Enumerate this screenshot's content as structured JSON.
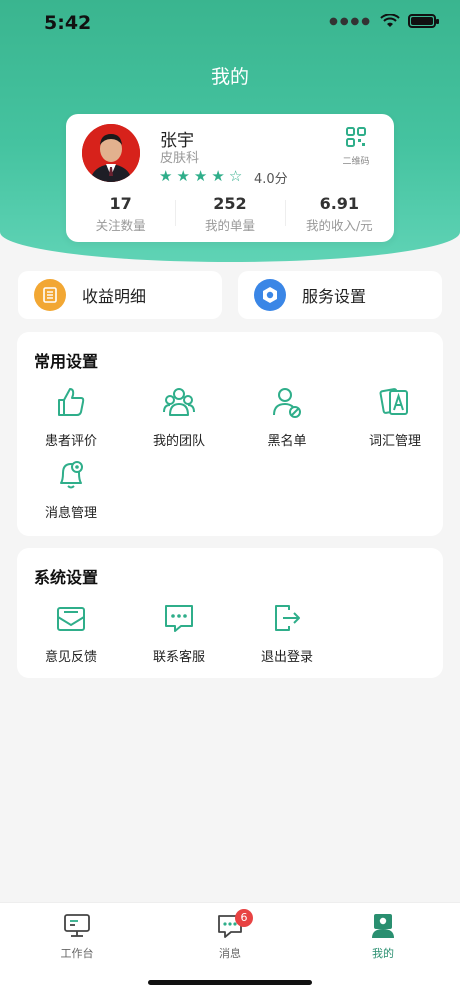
{
  "status_bar": {
    "time": "5:42"
  },
  "header": {
    "title": "我的"
  },
  "profile": {
    "name": "张宇",
    "department": "皮肤科",
    "rating_stars": 4,
    "rating_max": 5,
    "score": "4.0分",
    "qr_label": "二维码",
    "stats": [
      {
        "value": "17",
        "label": "关注数量"
      },
      {
        "value": "252",
        "label": "我的单量"
      },
      {
        "value": "6.91",
        "label": "我的收入/元"
      }
    ]
  },
  "quick_cards": [
    {
      "label": "收益明细",
      "icon": "ledger-icon",
      "color": "#f2a733"
    },
    {
      "label": "服务设置",
      "icon": "service-settings-icon",
      "color": "#3a86e6"
    }
  ],
  "common_settings": {
    "title": "常用设置",
    "items": [
      {
        "label": "患者评价",
        "icon": "thumbs-up-icon"
      },
      {
        "label": "我的团队",
        "icon": "team-icon"
      },
      {
        "label": "黑名单",
        "icon": "blacklist-icon"
      },
      {
        "label": "词汇管理",
        "icon": "vocabulary-icon"
      },
      {
        "label": "消息管理",
        "icon": "message-bell-icon"
      }
    ]
  },
  "system_settings": {
    "title": "系统设置",
    "items": [
      {
        "label": "意见反馈",
        "icon": "feedback-mail-icon"
      },
      {
        "label": "联系客服",
        "icon": "customer-service-icon"
      },
      {
        "label": "退出登录",
        "icon": "logout-icon"
      }
    ]
  },
  "tabbar": {
    "items": [
      {
        "label": "工作台",
        "icon": "workbench-icon"
      },
      {
        "label": "消息",
        "icon": "message-icon",
        "badge": "6"
      },
      {
        "label": "我的",
        "icon": "profile-icon",
        "active": true
      }
    ]
  },
  "colors": {
    "primary": "#3ab58f",
    "accent_green": "#2fae8a",
    "badge_red": "#e84343"
  }
}
